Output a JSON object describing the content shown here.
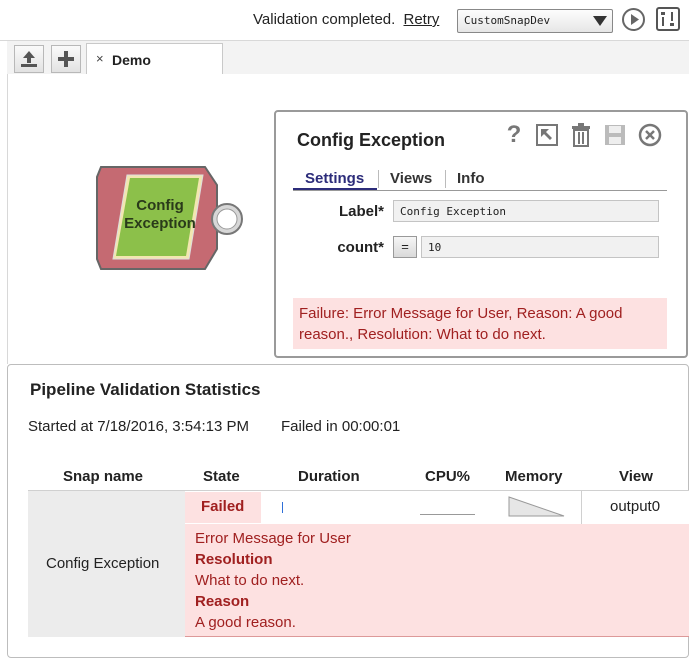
{
  "topbar": {
    "status_text": "Validation completed.",
    "retry_label": "Retry",
    "org_select_value": "CustomSnapDev",
    "icons": [
      "execute-icon",
      "settings-icon"
    ]
  },
  "tabs": {
    "upload_icon": "upload-icon",
    "add_icon": "plus-icon",
    "close_glyph": "×",
    "active_tab": "Demo"
  },
  "canvas": {
    "snap": {
      "name_line1": "Config",
      "name_line2": "Exception",
      "body_color": "#c56a72",
      "inner_color": "#8cc04a"
    }
  },
  "snap_panel": {
    "title": "Config Exception",
    "icons": [
      "help-icon",
      "open-icon",
      "delete-icon",
      "save-icon",
      "close-icon"
    ],
    "tabs": [
      "Settings",
      "Views",
      "Info"
    ],
    "fields": {
      "label_label": "Label*",
      "label_value": "Config Exception",
      "count_label": "count*",
      "eq_label": "=",
      "count_value": "10"
    },
    "failure_text": "Failure: Error Message for User, Reason: A good reason., Resolution: What to do next."
  },
  "stats": {
    "title": "Pipeline Validation Statistics",
    "started": "Started at 7/18/2016, 3:54:13 PM",
    "failed_in": "Failed in 00:00:01",
    "columns": [
      "Snap name",
      "State",
      "Duration",
      "CPU%",
      "Memory",
      "View"
    ],
    "row": {
      "snap_name": "Config Exception",
      "state": "Failed",
      "view": "output0",
      "error_lines": [
        {
          "text": "Error Message for User",
          "bold": false
        },
        {
          "text": "Resolution",
          "bold": true
        },
        {
          "text": "What to do next.",
          "bold": false
        },
        {
          "text": "Reason",
          "bold": true
        },
        {
          "text": "A good reason.",
          "bold": false
        }
      ]
    }
  },
  "colors": {
    "error_bg": "#fde1e1",
    "error_text": "#a02020",
    "accent_tab": "#2c2c7a"
  }
}
